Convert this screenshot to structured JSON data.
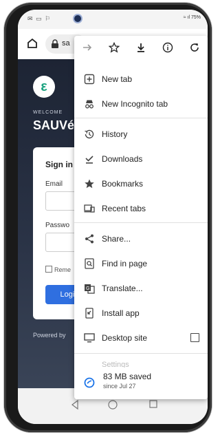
{
  "statusbar": {
    "left_icons": "✉ ▭ ⚐",
    "right_text": "≈ ıl 75%"
  },
  "browser": {
    "url": "sa"
  },
  "page": {
    "logo_letter": "ε",
    "welcome": "WELCOME",
    "brand": "SAUVé",
    "signin": "Sign in",
    "email_label": "Email",
    "password_label": "Passwo",
    "remember": "Reme",
    "login": "Login",
    "powered": "Powered by"
  },
  "menu": {
    "top_buttons": [
      "forward-icon",
      "star-icon",
      "download-icon",
      "info-icon",
      "refresh-icon"
    ],
    "items": [
      {
        "label": "New tab",
        "icon": "new-tab-icon"
      },
      {
        "label": "New Incognito tab",
        "icon": "incognito-icon"
      },
      {
        "label": "History",
        "icon": "history-icon"
      },
      {
        "label": "Downloads",
        "icon": "downloads-icon"
      },
      {
        "label": "Bookmarks",
        "icon": "bookmarks-icon"
      },
      {
        "label": "Recent tabs",
        "icon": "recent-tabs-icon"
      },
      {
        "label": "Share...",
        "icon": "share-icon"
      },
      {
        "label": "Find in page",
        "icon": "find-icon"
      },
      {
        "label": "Translate...",
        "icon": "translate-icon"
      },
      {
        "label": "Install app",
        "icon": "install-app-icon"
      },
      {
        "label": "Desktop site",
        "icon": "desktop-icon"
      }
    ],
    "faded_label": "Settings",
    "saved_main": "83 MB saved",
    "saved_sub": "since Jul 27",
    "accent": "#1a73e8"
  }
}
